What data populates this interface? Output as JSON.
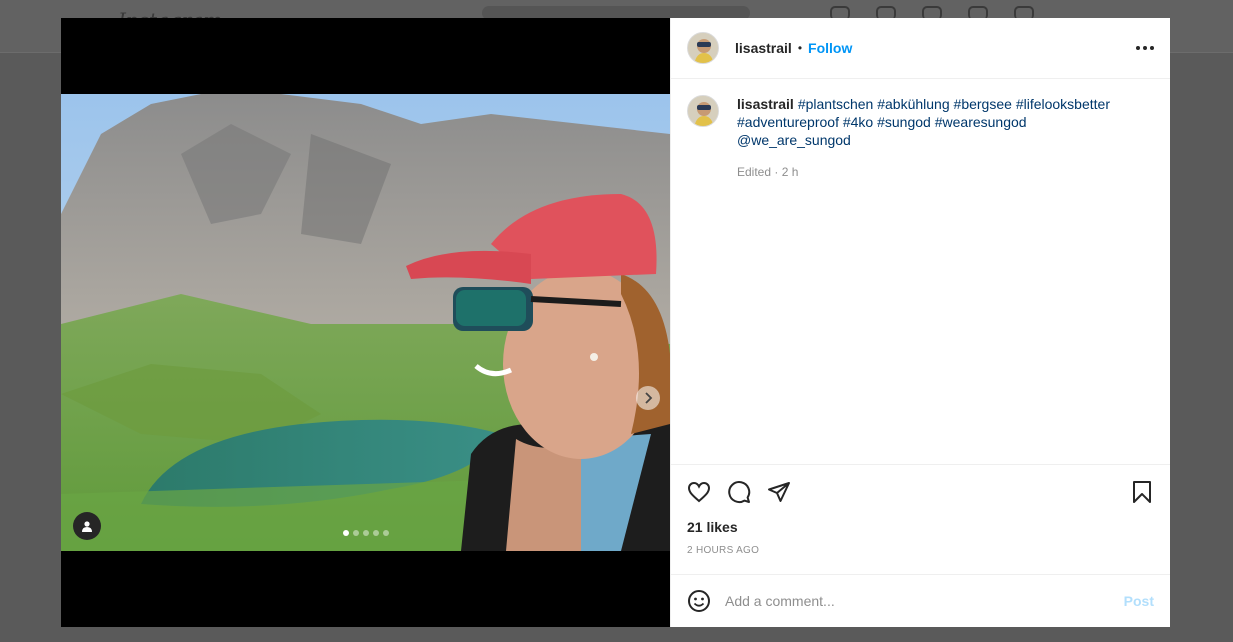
{
  "background": {
    "logo_text": "Instagram"
  },
  "post": {
    "username": "lisastrail",
    "separator": "•",
    "follow_label": "Follow",
    "caption": {
      "username": "lisastrail",
      "hashtags": [
        "#plantschen",
        "#abkühlung",
        "#bergsee",
        "#lifelooksbetter",
        "#adventureproof",
        "#4ko",
        "#sungod",
        "#wearesungod"
      ],
      "mention": "@we_are_sungod"
    },
    "edited_meta": "Edited · 2 h",
    "likes": "21 likes",
    "timestamp": "2 HOURS AGO",
    "carousel": {
      "total_slides": 5,
      "active_slide": 1
    }
  },
  "comment": {
    "placeholder": "Add a comment...",
    "post_label": "Post"
  },
  "colors": {
    "follow": "#0095f6",
    "link": "#00376b",
    "post_disabled": "#b2dffc",
    "muted": "#8e8e8e"
  },
  "icons": [
    "heart-icon",
    "comment-icon",
    "share-icon",
    "bookmark-icon",
    "emoji-icon",
    "more-icon",
    "chevron-right-icon",
    "user-tag-icon"
  ]
}
